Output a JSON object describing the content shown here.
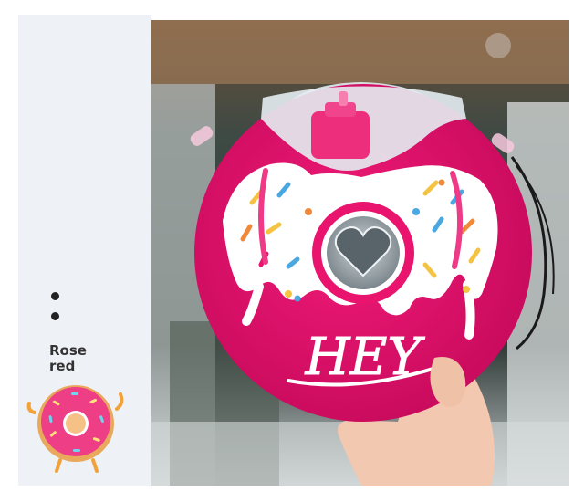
{
  "variant": {
    "label_line1": "Rose",
    "label_line2": "red"
  },
  "product": {
    "lettering": "HEY"
  },
  "colors": {
    "donut_pink": "#e8146e",
    "icing": "#ffffff",
    "lid": "#d8e4ec",
    "panel": "#eef1f5"
  }
}
